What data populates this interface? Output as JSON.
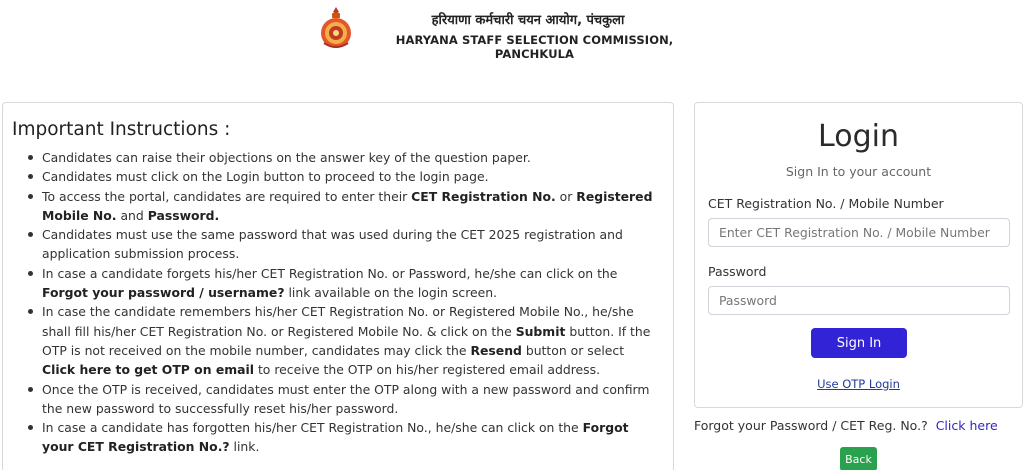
{
  "header": {
    "title_hindi": "हरियाणा कर्मचारी चयन आयोग, पंचकुला",
    "title_english": "HARYANA STAFF SELECTION COMMISSION, PANCHKULA",
    "emblem_icon": "haryana-emblem-icon"
  },
  "instructions": {
    "heading": "Important Instructions :",
    "items": [
      {
        "segments": [
          {
            "t": "Candidates can raise their objections on the answer key of the question paper."
          }
        ]
      },
      {
        "segments": [
          {
            "t": "Candidates must click on the Login button to proceed to the login page."
          }
        ]
      },
      {
        "segments": [
          {
            "t": "To access the portal, candidates are required to enter their "
          },
          {
            "t": "CET Registration No.",
            "b": true
          },
          {
            "t": " or "
          },
          {
            "t": "Registered Mobile No.",
            "b": true
          },
          {
            "t": " and "
          },
          {
            "t": "Password.",
            "b": true
          }
        ]
      },
      {
        "segments": [
          {
            "t": "Candidates must use the same password that was used during the CET 2025 registration and application submission process."
          }
        ]
      },
      {
        "segments": [
          {
            "t": "In case a candidate forgets his/her CET Registration No. or Password, he/she can click on the "
          },
          {
            "t": "Forgot your password / username?",
            "b": true
          },
          {
            "t": " link available on the login screen."
          }
        ]
      },
      {
        "segments": [
          {
            "t": "In case the candidate remembers his/her CET Registration No. or Registered Mobile No., he/she shall fill his/her CET Registration No. or Registered Mobile No. & click on the "
          },
          {
            "t": "Submit",
            "b": true
          },
          {
            "t": " button. If the OTP is not received on the mobile number, candidates may click the "
          },
          {
            "t": "Resend",
            "b": true
          },
          {
            "t": " button or select "
          },
          {
            "t": "Click here to get OTP on email",
            "b": true
          },
          {
            "t": " to receive the OTP on his/her registered email address."
          }
        ]
      },
      {
        "segments": [
          {
            "t": "Once the OTP is received, candidates must enter the OTP along with a new password and confirm the new password to successfully reset his/her password."
          }
        ]
      },
      {
        "segments": [
          {
            "t": "In case a candidate has forgotten his/her CET Registration No., he/she can click on the "
          },
          {
            "t": "Forgot your CET Registration No.?",
            "b": true
          },
          {
            "t": " link."
          }
        ]
      }
    ]
  },
  "login": {
    "title": "Login",
    "subtitle": "Sign In to your account",
    "reg_label": "CET Registration No. / Mobile Number",
    "reg_value": "",
    "reg_placeholder": "Enter CET Registration No. / Mobile Number",
    "password_label": "Password",
    "password_value": "",
    "password_placeholder": "Password",
    "signin_label": "Sign In",
    "otp_link": "Use OTP Login"
  },
  "footer": {
    "forgot_text": "Forgot your Password / CET Reg. No.?",
    "click_here": "Click here",
    "back_label": "Back"
  },
  "colors": {
    "primary_button": "#3223d6",
    "back_button": "#2aa14c",
    "link": "#2f25c9"
  }
}
